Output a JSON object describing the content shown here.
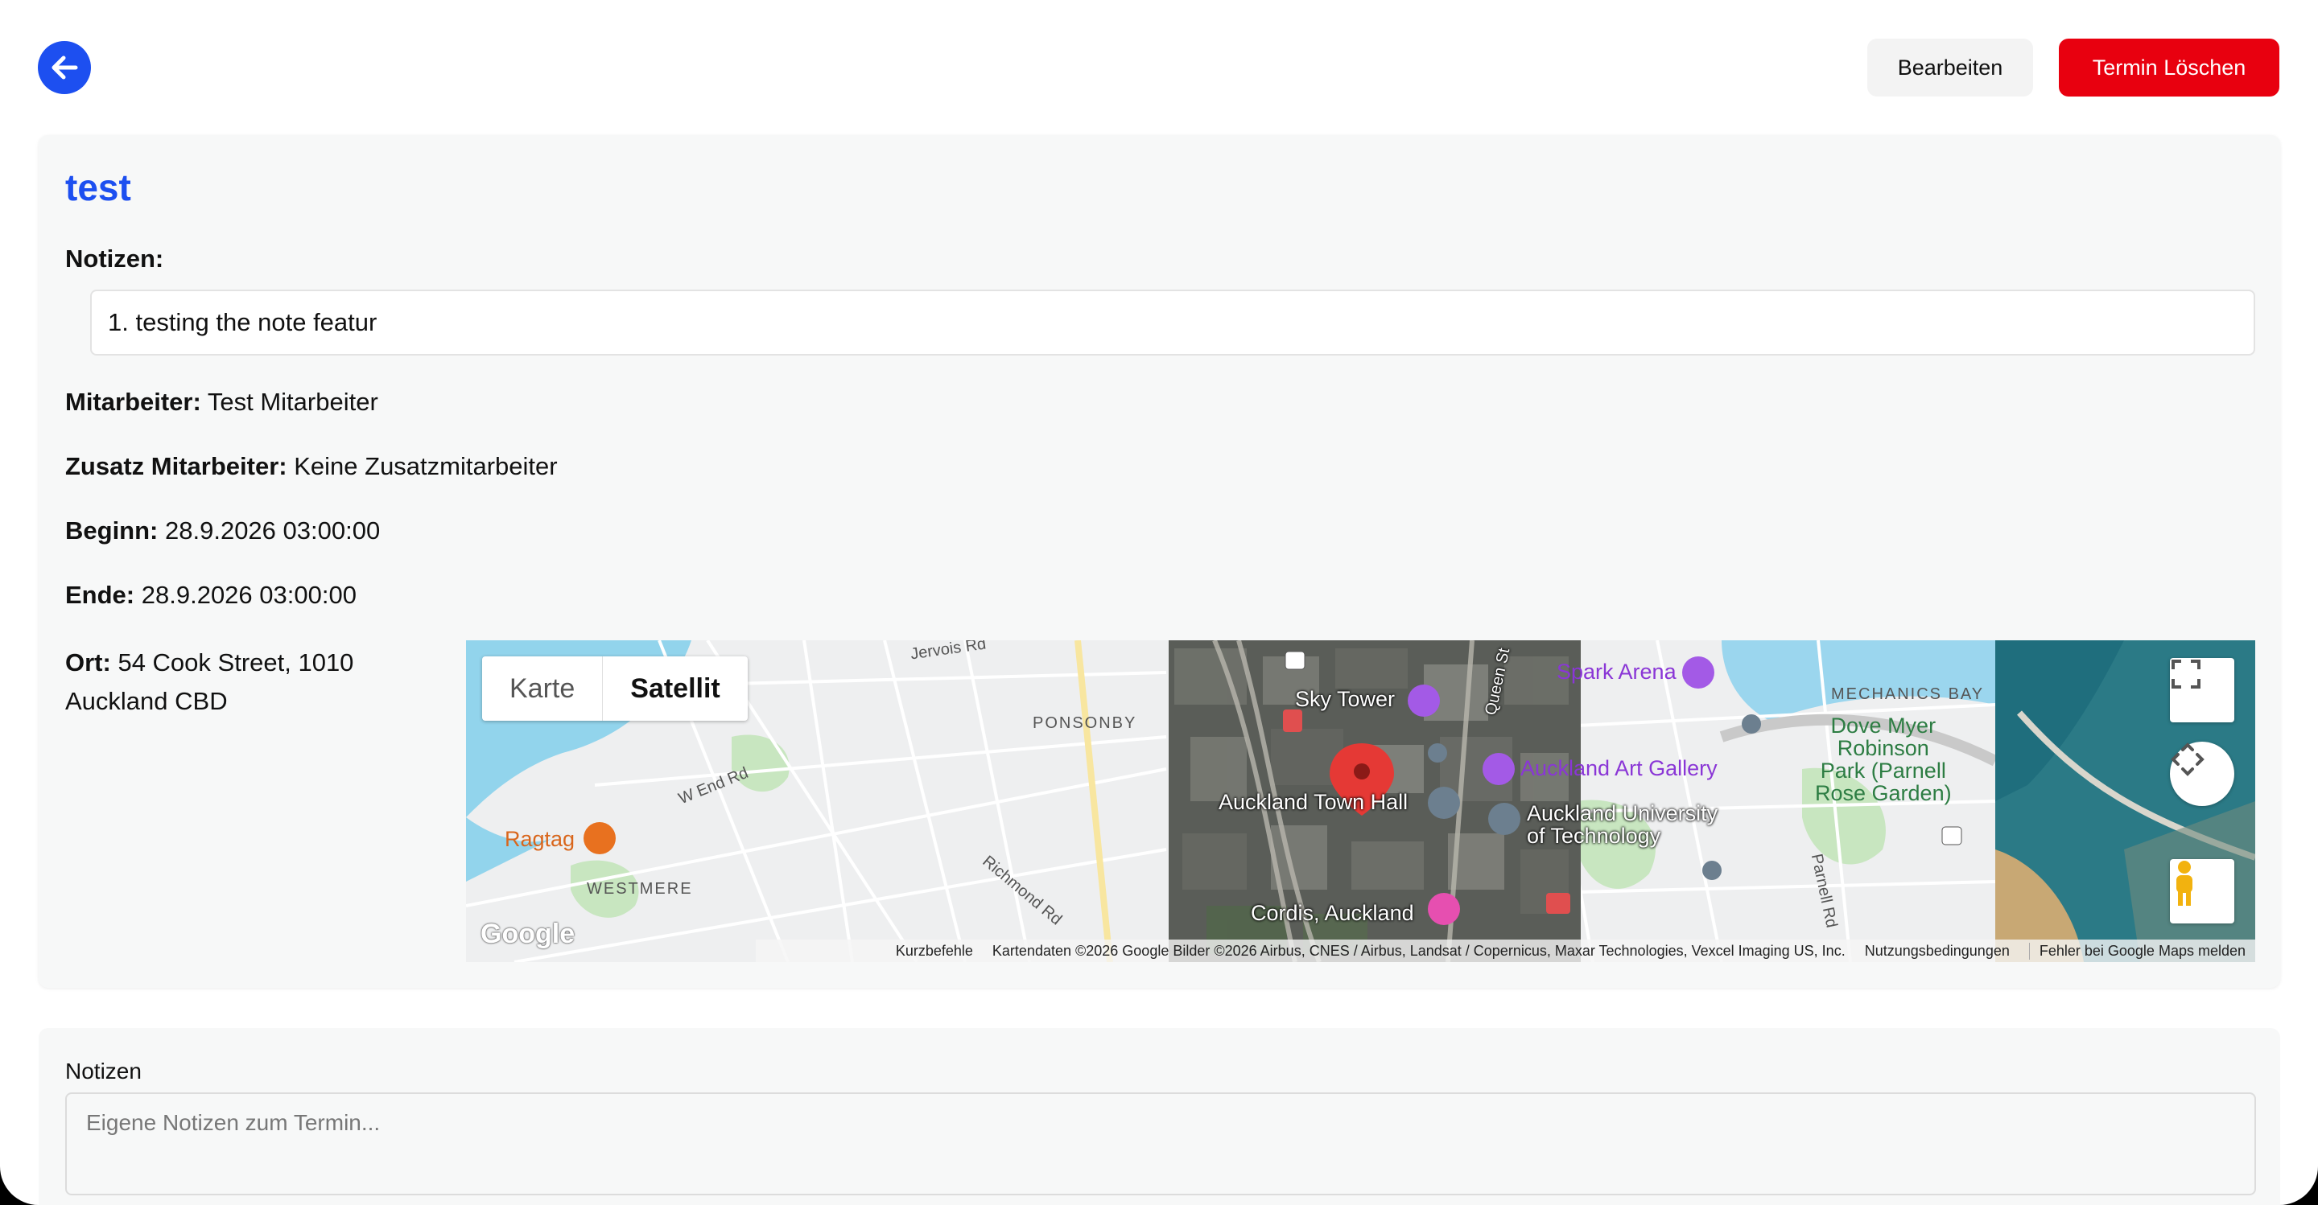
{
  "header": {
    "edit_label": "Bearbeiten",
    "delete_label": "Termin Löschen"
  },
  "appointment": {
    "title": "test",
    "notes_label": "Notizen:",
    "note_item": "1. testing the note featur",
    "employee_label": "Mitarbeiter:",
    "employee_value": "Test Mitarbeiter",
    "extra_employee_label": "Zusatz Mitarbeiter:",
    "extra_employee_value": "Keine Zusatzmitarbeiter",
    "start_label": "Beginn:",
    "start_value": "28.9.2026 03:00:00",
    "end_label": "Ende:",
    "end_value": "28.9.2026 03:00:00",
    "location_label": "Ort:",
    "location_line1": "54 Cook Street, 1010",
    "location_line2": "Auckland CBD"
  },
  "map": {
    "type_map": "Karte",
    "type_satellite": "Satellit",
    "labels": {
      "jervois": "Jervois Rd",
      "ponsonby": "PONSONBY",
      "wend": "W End Rd",
      "ragtag": "Ragtag",
      "westmere": "WESTMERE",
      "richmond": "Richmond Rd",
      "skytower": "Sky Tower",
      "queen": "Queen St",
      "townhall": "Auckland Town Hall",
      "cordis": "Cordis, Auckland",
      "spark": "Spark Arena",
      "artgallery": "Auckland Art Gallery",
      "aut1": "Auckland University",
      "aut2": "of Technology",
      "mechanics": "MECHANICS BAY",
      "dove1": "Dove Myer",
      "dove2": "Robinson",
      "dove3": "Park (Parnell",
      "dove4": "Rose Garden)",
      "parnell": "Parnell Rd",
      "google": "Google"
    },
    "footer": {
      "shortcuts": "Kurzbefehle",
      "attribution": "Kartendaten ©2026 Google Bilder ©2026 Airbus, CNES / Airbus, Landsat / Copernicus, Maxar Technologies, Vexcel Imaging US, Inc.",
      "terms": "Nutzungsbedingungen",
      "report": "Fehler bei Google Maps melden"
    },
    "marker_color": "#e53935"
  },
  "own_notes": {
    "label": "Notizen",
    "placeholder": "Eigene Notizen zum Termin..."
  }
}
